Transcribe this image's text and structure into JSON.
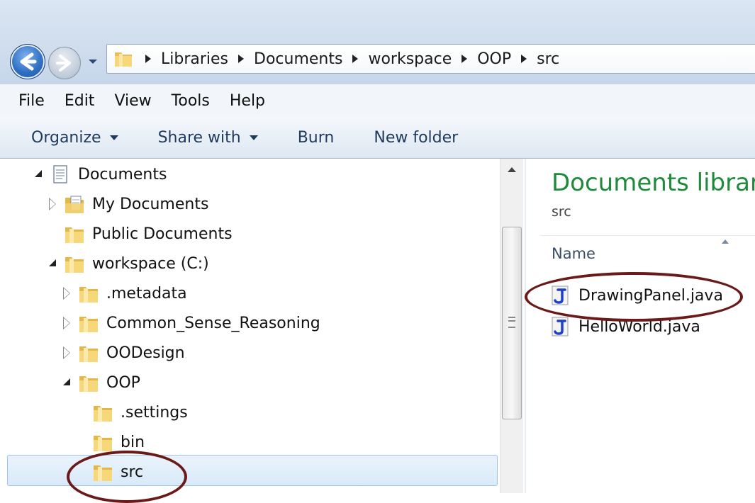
{
  "address_bar": {
    "breadcrumbs": [
      "Libraries",
      "Documents",
      "workspace",
      "OOP",
      "src"
    ]
  },
  "menu": [
    "File",
    "Edit",
    "View",
    "Tools",
    "Help"
  ],
  "toolbar": {
    "organize": "Organize",
    "share_with": "Share with",
    "burn": "Burn",
    "new_folder": "New folder"
  },
  "tree": [
    {
      "label": "Documents",
      "indent": 0,
      "expander": "open",
      "icon": "documents-library-icon"
    },
    {
      "label": "My Documents",
      "indent": 1,
      "expander": "closed",
      "icon": "documents-folder-icon"
    },
    {
      "label": "Public Documents",
      "indent": 1,
      "expander": "none",
      "icon": "folder-icon"
    },
    {
      "label": "workspace (C:)",
      "indent": 1,
      "expander": "open",
      "icon": "folder-icon"
    },
    {
      "label": ".metadata",
      "indent": 2,
      "expander": "closed",
      "icon": "folder-icon"
    },
    {
      "label": "Common_Sense_Reasoning",
      "indent": 2,
      "expander": "closed",
      "icon": "folder-icon"
    },
    {
      "label": "OODesign",
      "indent": 2,
      "expander": "closed",
      "icon": "folder-icon"
    },
    {
      "label": "OOP",
      "indent": 2,
      "expander": "open",
      "icon": "folder-icon"
    },
    {
      "label": ".settings",
      "indent": 3,
      "expander": "none",
      "icon": "folder-icon"
    },
    {
      "label": "bin",
      "indent": 3,
      "expander": "none",
      "icon": "folder-icon"
    },
    {
      "label": "src",
      "indent": 3,
      "expander": "none",
      "icon": "folder-icon",
      "selected": true
    }
  ],
  "content": {
    "library_title": "Documents library",
    "library_subtitle": "src",
    "column_name": "Name",
    "files": [
      {
        "name": "DrawingPanel.java",
        "icon": "java-file-icon"
      },
      {
        "name": "HelloWorld.java",
        "icon": "java-file-icon"
      }
    ]
  },
  "colors": {
    "library_title": "#1f8a3b",
    "selection": "#d9eaf9",
    "annotation_ellipse": "#6b1a1a"
  }
}
